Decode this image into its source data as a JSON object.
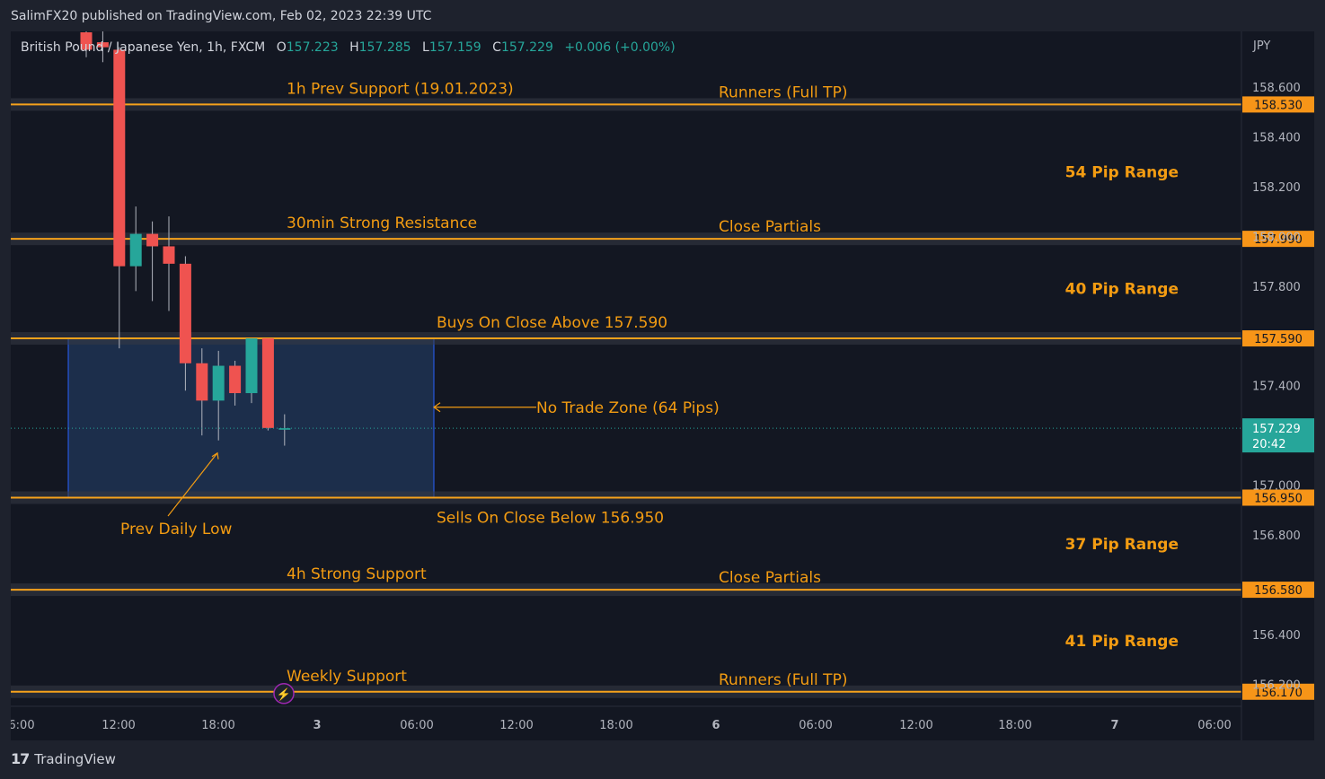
{
  "header": {
    "published": "SalimFX20 published on TradingView.com, Feb 02, 2023 22:39 UTC"
  },
  "footer": {
    "brand": "TradingView"
  },
  "symbol": {
    "name": "British Pound / Japanese Yen, 1h, FXCM",
    "o_label": "O",
    "o": "157.223",
    "h_label": "H",
    "h": "157.285",
    "l_label": "L",
    "l": "157.159",
    "c_label": "C",
    "c": "157.229",
    "change": "+0.006 (+0.00%)"
  },
  "colors": {
    "background": "#131722",
    "up": "#26a69a",
    "down": "#ef5350",
    "level_line": "#f7a21b",
    "annotation": "#f39c12",
    "zone_fill": "#1f3252",
    "zone_border": "#2962ff",
    "price_tag": "#f79518",
    "last_price": "#26a69a"
  },
  "chart_data": {
    "type": "candlestick",
    "currency": "JPY",
    "ylim": [
      156.1,
      158.85
    ],
    "y_ticks": [
      "158.600",
      "158.400",
      "158.200",
      "158.000",
      "157.800",
      "157.400",
      "157.000",
      "156.800",
      "156.400",
      "156.200"
    ],
    "x_ticks": [
      "6:00",
      "12:00",
      "18:00",
      "3",
      "06:00",
      "12:00",
      "18:00",
      "6",
      "06:00",
      "12:00",
      "18:00",
      "7",
      "06:00"
    ],
    "candles": [
      {
        "o": 158.82,
        "h": 158.85,
        "l": 158.72,
        "c": 158.75
      },
      {
        "o": 158.78,
        "h": 158.85,
        "l": 158.7,
        "c": 158.76
      },
      {
        "o": 158.75,
        "h": 158.76,
        "l": 157.55,
        "c": 157.88
      },
      {
        "o": 157.88,
        "h": 158.12,
        "l": 157.78,
        "c": 158.01
      },
      {
        "o": 158.01,
        "h": 158.06,
        "l": 157.74,
        "c": 157.96
      },
      {
        "o": 157.96,
        "h": 158.08,
        "l": 157.7,
        "c": 157.89
      },
      {
        "o": 157.89,
        "h": 157.92,
        "l": 157.38,
        "c": 157.49
      },
      {
        "o": 157.49,
        "h": 157.55,
        "l": 157.2,
        "c": 157.34
      },
      {
        "o": 157.34,
        "h": 157.54,
        "l": 157.18,
        "c": 157.48
      },
      {
        "o": 157.48,
        "h": 157.5,
        "l": 157.32,
        "c": 157.37
      },
      {
        "o": 157.37,
        "h": 157.59,
        "l": 157.33,
        "c": 157.59
      },
      {
        "o": 157.59,
        "h": 157.59,
        "l": 157.22,
        "c": 157.23
      },
      {
        "o": 157.223,
        "h": 157.285,
        "l": 157.159,
        "c": 157.229
      }
    ],
    "levels": [
      {
        "price": 158.53,
        "tag": "158.530",
        "label_left": "1h Prev Support (19.01.2023)",
        "label_right": "Runners (Full TP)"
      },
      {
        "price": 157.99,
        "tag": "157.990",
        "label_left": "30min Strong Resistance",
        "label_right": "Close Partials"
      },
      {
        "price": 157.59,
        "tag": "157.590",
        "label_left": "Buys On Close Above 157.590",
        "label_right": ""
      },
      {
        "price": 156.95,
        "tag": "156.950",
        "label_left": "Sells On Close Below 156.950",
        "label_right": ""
      },
      {
        "price": 156.58,
        "tag": "156.580",
        "label_left": "4h Strong Support",
        "label_right": "Close Partials"
      },
      {
        "price": 156.17,
        "tag": "156.170",
        "label_left": "Weekly Support",
        "label_right": "Runners (Full TP)"
      }
    ],
    "ranges": [
      "54 Pip Range",
      "40 Pip Range",
      "37 Pip Range",
      "41 Pip Range"
    ],
    "zone": {
      "top": 157.59,
      "bottom": 156.95,
      "label": "No Trade Zone (64 Pips)"
    },
    "prev_daily_low": {
      "label": "Prev Daily Low",
      "price": 157.18
    },
    "last_price": {
      "value": "157.229",
      "countdown": "20:42",
      "price": 157.229
    }
  }
}
